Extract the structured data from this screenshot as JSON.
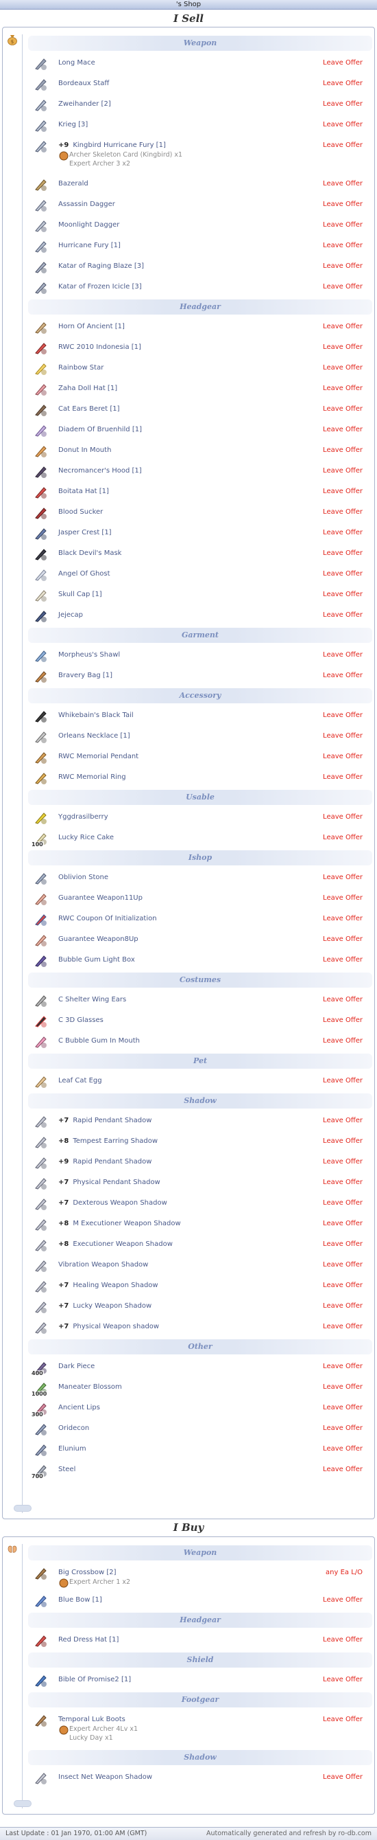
{
  "topbar": {
    "title": "'s Shop"
  },
  "sell": {
    "heading": "I Sell",
    "categories": [
      {
        "label": "Weapon",
        "items": [
          {
            "icon": "mace-icon",
            "name": "Long Mace",
            "offer": "Leave Offer"
          },
          {
            "icon": "mace-icon",
            "name": "Bordeaux Staff",
            "offer": "Leave Offer"
          },
          {
            "icon": "sword-icon",
            "name": "Zweihander [2]",
            "offer": "Leave Offer"
          },
          {
            "icon": "sword-icon",
            "name": "Krieg [3]",
            "offer": "Leave Offer"
          },
          {
            "icon": "sword-icon",
            "refine": "+9",
            "name": "Kingbird Hurricane Fury [1]",
            "offer": "Leave Offer",
            "sub": [
              "Archer Skeleton Card (Kingbird) x1",
              "Expert Archer 3 x2"
            ]
          },
          {
            "icon": "axe-icon",
            "name": "Bazerald",
            "offer": "Leave Offer"
          },
          {
            "icon": "dagger-icon",
            "name": "Assassin Dagger",
            "offer": "Leave Offer"
          },
          {
            "icon": "dagger-icon",
            "name": "Moonlight Dagger",
            "offer": "Leave Offer"
          },
          {
            "icon": "sword-icon",
            "name": "Hurricane Fury [1]",
            "offer": "Leave Offer"
          },
          {
            "icon": "katar-icon",
            "name": "Katar of Raging Blaze [3]",
            "offer": "Leave Offer"
          },
          {
            "icon": "katar-icon",
            "name": "Katar of Frozen Icicle [3]",
            "offer": "Leave Offer"
          }
        ]
      },
      {
        "label": "Headgear",
        "items": [
          {
            "icon": "helm-icon",
            "name": "Horn Of Ancient [1]",
            "offer": "Leave Offer"
          },
          {
            "icon": "hat-icon",
            "name": "RWC 2010 Indonesia [1]",
            "offer": "Leave Offer"
          },
          {
            "icon": "star-icon",
            "name": "Rainbow Star",
            "offer": "Leave Offer"
          },
          {
            "icon": "doll-icon",
            "name": "Zaha Doll Hat [1]",
            "offer": "Leave Offer"
          },
          {
            "icon": "beret-icon",
            "name": "Cat Ears Beret [1]",
            "offer": "Leave Offer"
          },
          {
            "icon": "diadem-icon",
            "name": "Diadem Of Bruenhild [1]",
            "offer": "Leave Offer"
          },
          {
            "icon": "donut-icon",
            "name": "Donut In Mouth",
            "offer": "Leave Offer"
          },
          {
            "icon": "hood-icon",
            "name": "Necromancer's Hood [1]",
            "offer": "Leave Offer"
          },
          {
            "icon": "hat-icon",
            "name": "Boitata Hat [1]",
            "offer": "Leave Offer"
          },
          {
            "icon": "blood-icon",
            "name": "Blood Sucker",
            "offer": "Leave Offer"
          },
          {
            "icon": "crest-icon",
            "name": "Jasper Crest [1]",
            "offer": "Leave Offer"
          },
          {
            "icon": "mask-icon",
            "name": "Black Devil's Mask",
            "offer": "Leave Offer"
          },
          {
            "icon": "ghost-icon",
            "name": "Angel Of Ghost",
            "offer": "Leave Offer"
          },
          {
            "icon": "skull-icon",
            "name": "Skull Cap [1]",
            "offer": "Leave Offer"
          },
          {
            "icon": "cap-icon",
            "name": "Jejecap",
            "offer": "Leave Offer"
          }
        ]
      },
      {
        "label": "Garment",
        "items": [
          {
            "icon": "shawl-icon",
            "name": "Morpheus's Shawl",
            "offer": "Leave Offer"
          },
          {
            "icon": "bag-icon",
            "name": "Bravery Bag [1]",
            "offer": "Leave Offer"
          }
        ]
      },
      {
        "label": "Accessory",
        "items": [
          {
            "icon": "tail-icon",
            "name": "Whikebain's Black Tail",
            "offer": "Leave Offer"
          },
          {
            "icon": "necklace-icon",
            "name": "Orleans Necklace [1]",
            "offer": "Leave Offer"
          },
          {
            "icon": "pendant-icon",
            "name": "RWC Memorial Pendant",
            "offer": "Leave Offer"
          },
          {
            "icon": "ring-icon",
            "name": "RWC Memorial Ring",
            "offer": "Leave Offer"
          }
        ]
      },
      {
        "label": "Usable",
        "items": [
          {
            "icon": "berry-icon",
            "name": "Yggdrasilberry",
            "offer": "Leave Offer"
          },
          {
            "icon": "cake-icon",
            "qty": "100",
            "name": "Lucky Rice Cake",
            "offer": "Leave Offer"
          }
        ]
      },
      {
        "label": "Ishop",
        "items": [
          {
            "icon": "stone-icon",
            "name": "Oblivion Stone",
            "offer": "Leave Offer"
          },
          {
            "icon": "scroll-icon",
            "name": "Guarantee Weapon11Up",
            "offer": "Leave Offer"
          },
          {
            "icon": "coupon-icon",
            "name": "RWC Coupon Of Initialization",
            "offer": "Leave Offer"
          },
          {
            "icon": "scroll-icon",
            "name": "Guarantee Weapon8Up",
            "offer": "Leave Offer"
          },
          {
            "icon": "box-icon",
            "name": "Bubble Gum Light Box",
            "offer": "Leave Offer"
          }
        ]
      },
      {
        "label": "Costumes",
        "items": [
          {
            "icon": "wing-icon",
            "name": "C Shelter Wing Ears",
            "offer": "Leave Offer"
          },
          {
            "icon": "glasses-icon",
            "name": "C 3D Glasses",
            "offer": "Leave Offer"
          },
          {
            "icon": "gum-icon",
            "name": "C Bubble Gum In Mouth",
            "offer": "Leave Offer"
          }
        ]
      },
      {
        "label": "Pet",
        "items": [
          {
            "icon": "egg-icon",
            "name": "Leaf Cat Egg",
            "offer": "Leave Offer"
          }
        ]
      },
      {
        "label": "Shadow",
        "items": [
          {
            "icon": "shadow-icon",
            "refine": "+7",
            "name": "Rapid Pendant Shadow",
            "offer": "Leave Offer"
          },
          {
            "icon": "shadow-icon",
            "refine": "+8",
            "name": "Tempest Earring Shadow",
            "offer": "Leave Offer"
          },
          {
            "icon": "shadow-icon",
            "refine": "+9",
            "name": "Rapid Pendant Shadow",
            "offer": "Leave Offer"
          },
          {
            "icon": "shadow-icon",
            "refine": "+7",
            "name": "Physical Pendant Shadow",
            "offer": "Leave Offer"
          },
          {
            "icon": "shadow-icon",
            "refine": "+7",
            "name": "Dexterous Weapon Shadow",
            "offer": "Leave Offer"
          },
          {
            "icon": "shadow-icon",
            "refine": "+8",
            "name": "M Executioner Weapon Shadow",
            "offer": "Leave Offer"
          },
          {
            "icon": "shadow-icon",
            "refine": "+8",
            "name": "Executioner Weapon Shadow",
            "offer": "Leave Offer"
          },
          {
            "icon": "shadow-icon",
            "name": "Vibration Weapon Shadow",
            "offer": "Leave Offer"
          },
          {
            "icon": "shadow-icon",
            "refine": "+7",
            "name": "Healing Weapon Shadow",
            "offer": "Leave Offer"
          },
          {
            "icon": "shadow-icon",
            "refine": "+7",
            "name": "Lucky Weapon Shadow",
            "offer": "Leave Offer"
          },
          {
            "icon": "shadow-icon",
            "refine": "+7",
            "name": "Physical Weapon shadow",
            "offer": "Leave Offer"
          }
        ]
      },
      {
        "label": "Other",
        "items": [
          {
            "icon": "piece-icon",
            "qty": "400",
            "name": "Dark Piece",
            "offer": "Leave Offer"
          },
          {
            "icon": "blossom-icon",
            "qty": "1000",
            "name": "Maneater Blossom",
            "offer": "Leave Offer"
          },
          {
            "icon": "lips-icon",
            "qty": "300",
            "name": "Ancient Lips",
            "offer": "Leave Offer"
          },
          {
            "icon": "ore-icon",
            "name": "Oridecon",
            "offer": "Leave Offer"
          },
          {
            "icon": "ore-icon",
            "name": "Elunium",
            "offer": "Leave Offer"
          },
          {
            "icon": "steel-icon",
            "qty": "700",
            "name": "Steel",
            "offer": "Leave Offer"
          }
        ]
      }
    ]
  },
  "buy": {
    "heading": "I Buy",
    "categories": [
      {
        "label": "Weapon",
        "items": [
          {
            "icon": "crossbow-icon",
            "name": "Big Crossbow [2]",
            "offer": "any Ea L/O",
            "sub": [
              "Expert Archer 1 x2"
            ]
          },
          {
            "icon": "bow-icon",
            "name": "Blue Bow [1]",
            "offer": "Leave Offer"
          }
        ]
      },
      {
        "label": "Headgear",
        "items": [
          {
            "icon": "hat-icon",
            "name": "Red Dress Hat [1]",
            "offer": "Leave Offer"
          }
        ]
      },
      {
        "label": "Shield",
        "items": [
          {
            "icon": "book-icon",
            "name": "Bible Of Promise2 [1]",
            "offer": "Leave Offer"
          }
        ]
      },
      {
        "label": "Footgear",
        "items": [
          {
            "icon": "boots-icon",
            "name": "Temporal Luk Boots",
            "offer": "Leave Offer",
            "sub": [
              "Expert Archer 4Lv x1",
              "Lucky Day x1"
            ]
          }
        ]
      },
      {
        "label": "Shadow",
        "items": [
          {
            "icon": "shadow-icon",
            "name": "Insect Net Weapon Shadow",
            "offer": "Leave Offer"
          }
        ]
      }
    ]
  },
  "footer": {
    "last_update": "Last Update : 01 Jan 1970, 01:00 AM (GMT)",
    "generated": "Automatically generated and refresh by ro-db.com"
  },
  "colors": {
    "offer_red": "#e2231a",
    "item_text": "#4a5a8a",
    "category_text": "#7b8fbe",
    "category_band": "#dfe6f3"
  }
}
